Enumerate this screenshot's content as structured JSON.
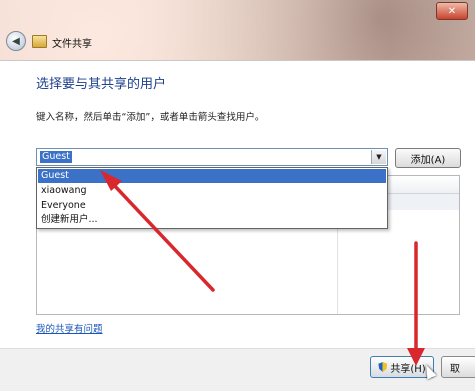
{
  "window": {
    "title": "文件共享",
    "close_label": "✕",
    "back_label": "◀"
  },
  "main": {
    "heading": "选择要与其共享的用户",
    "instruction": "键入名称，然后单击“添加”，或者单击箭头查找用户。"
  },
  "user_combo": {
    "value": "Guest",
    "arrow": "▼",
    "options": [
      "Guest",
      "xiaowang",
      "Everyone",
      "创建新用户..."
    ],
    "selected_index": 0
  },
  "add_button": {
    "label": "添加(A)"
  },
  "help_link": {
    "label": "我的共享有问题"
  },
  "footer": {
    "share_label": "共享(H)",
    "cancel_label": "取"
  },
  "colors": {
    "accent": "#3b71c6",
    "annotation_arrow": "#d9272e",
    "heading": "#1d3f8c"
  }
}
